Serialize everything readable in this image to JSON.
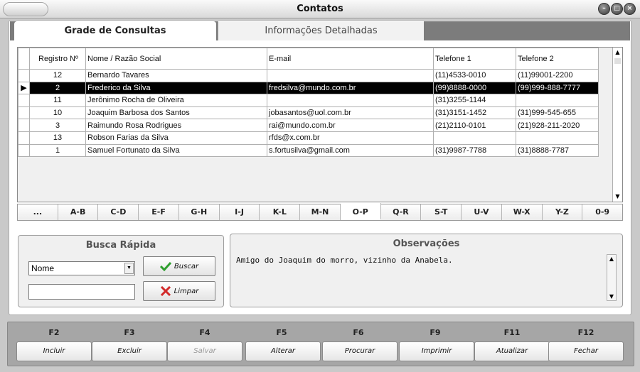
{
  "window": {
    "title": "Contatos"
  },
  "tabs": [
    {
      "label": "Grade de Consultas",
      "active": true
    },
    {
      "label": "Informações Detalhadas",
      "active": false
    }
  ],
  "grid": {
    "columns": [
      "Registro Nº",
      "Nome / Razão Social",
      "E-mail",
      "Telefone 1",
      "Telefone 2"
    ],
    "rows": [
      {
        "reg": "12",
        "nome": "Bernardo Tavares",
        "email": "",
        "tel1": "(11)4533-0010",
        "tel2": "(11)99001-2200",
        "selected": false
      },
      {
        "reg": "2",
        "nome": "Frederico da Silva",
        "email": "fredsilva@mundo.com.br",
        "tel1": "(99)8888-0000",
        "tel2": "(99)999-888-7777",
        "selected": true
      },
      {
        "reg": "11",
        "nome": "Jerônimo Rocha de Oliveira",
        "email": "",
        "tel1": "(31)3255-1144",
        "tel2": "",
        "selected": false
      },
      {
        "reg": "10",
        "nome": "Joaquim Barbosa dos Santos",
        "email": "jobasantos@uol.com.br",
        "tel1": "(31)3151-1452",
        "tel2": "(31)999-545-655",
        "selected": false
      },
      {
        "reg": "3",
        "nome": "Raimundo Rosa Rodrigues",
        "email": "rai@mundo.com.br",
        "tel1": "(21)2110-0101",
        "tel2": "(21)928-211-2020",
        "selected": false
      },
      {
        "reg": "13",
        "nome": "Robson Farias da Silva",
        "email": "rfds@x.com.br",
        "tel1": "",
        "tel2": "",
        "selected": false
      },
      {
        "reg": "1",
        "nome": "Samuel Fortunato da Silva",
        "email": "s.fortusilva@gmail.com",
        "tel1": "(31)9987-7788",
        "tel2": "(31)8888-7787",
        "selected": false
      }
    ]
  },
  "alpha_filter": {
    "items": [
      "...",
      "A-B",
      "C-D",
      "E-F",
      "G-H",
      "I-J",
      "K-L",
      "M-N",
      "O-P",
      "Q-R",
      "S-T",
      "U-V",
      "W-X",
      "Y-Z",
      "0-9"
    ],
    "selected": "O-P"
  },
  "busca": {
    "title": "Busca Rápida",
    "field_selected": "Nome",
    "query_value": "",
    "buscar_label": "Buscar",
    "limpar_label": "Limpar"
  },
  "observacoes": {
    "title": "Observações",
    "text": "Amigo do Joaquim do morro, vizinho da Anabela."
  },
  "footer": {
    "buttons": [
      {
        "key": "F2",
        "label": "Incluir",
        "enabled": true
      },
      {
        "key": "F3",
        "label": "Excluir",
        "enabled": true
      },
      {
        "key": "F4",
        "label": "Salvar",
        "enabled": false
      },
      {
        "key": "F5",
        "label": "Alterar",
        "enabled": true
      },
      {
        "key": "F6",
        "label": "Procurar",
        "enabled": true
      },
      {
        "key": "F9",
        "label": "Imprimir",
        "enabled": true
      },
      {
        "key": "F11",
        "label": "Atualizar",
        "enabled": true
      },
      {
        "key": "F12",
        "label": "Fechar",
        "enabled": true
      }
    ]
  },
  "colors": {
    "accent_check": "#2e9e2e",
    "accent_x": "#d22a2a",
    "selection": "#000000"
  }
}
